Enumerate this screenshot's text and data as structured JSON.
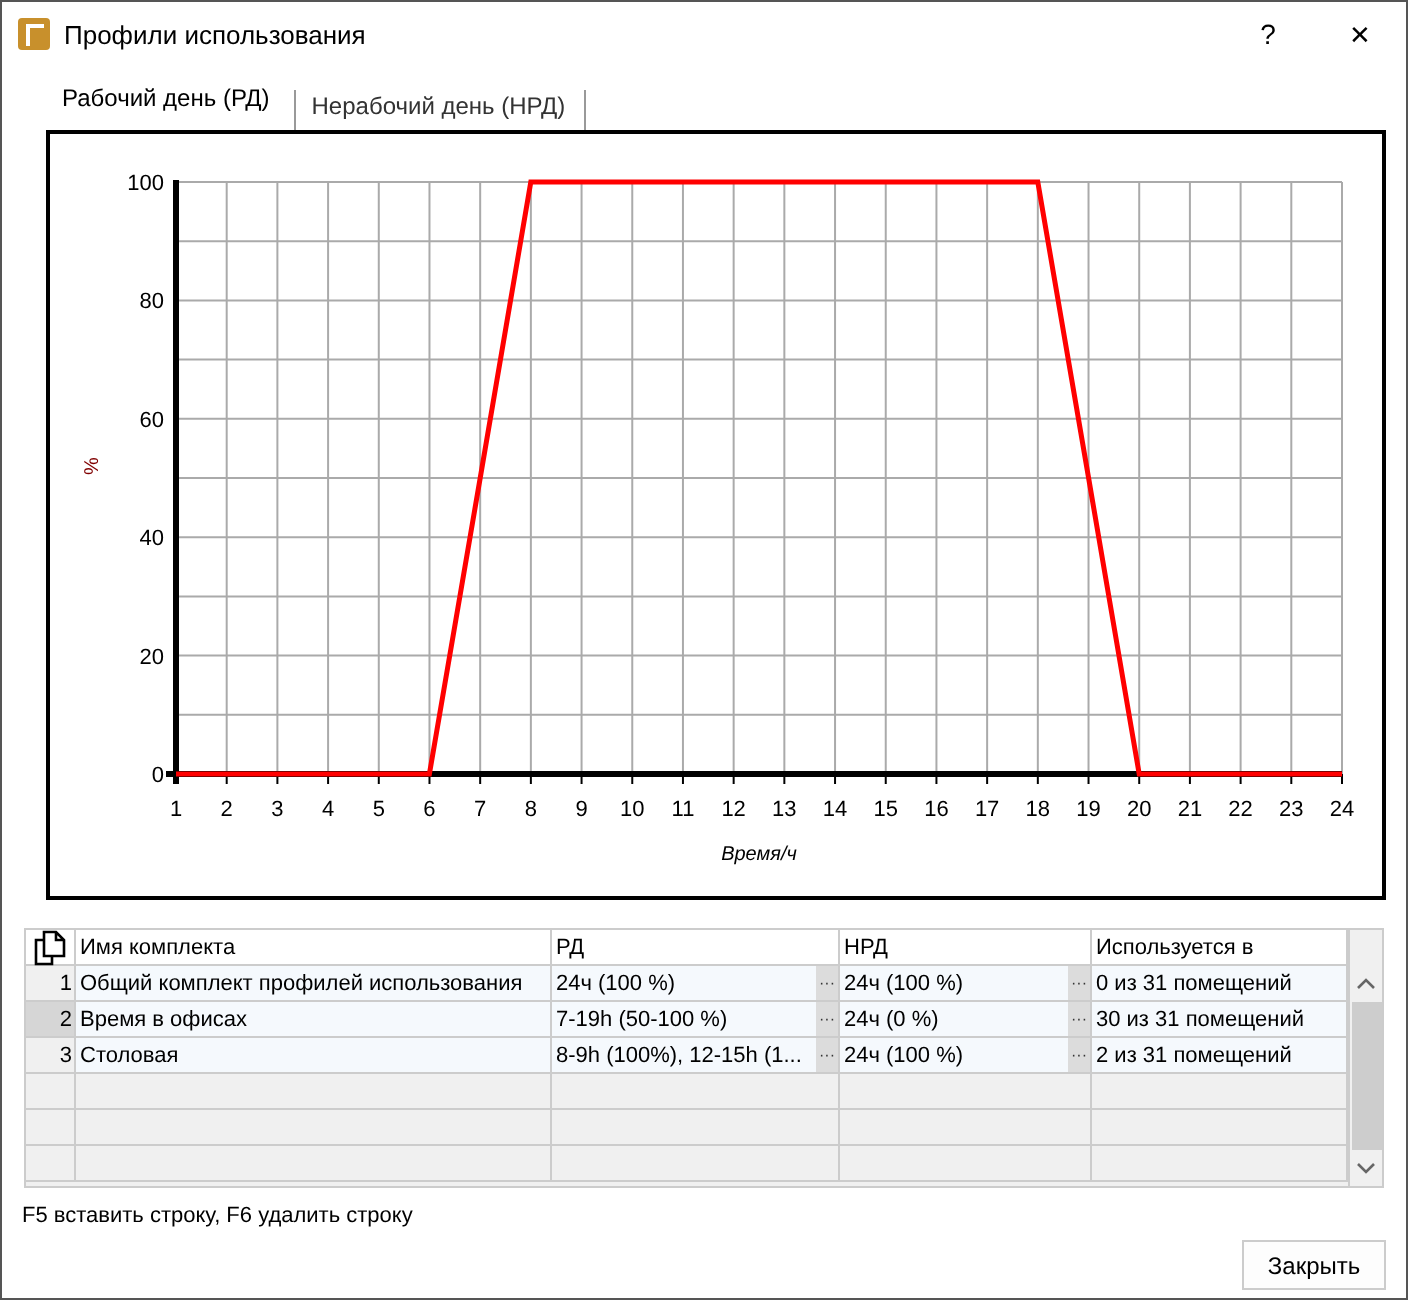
{
  "window": {
    "title": "Профили использования",
    "help": "?",
    "close": "✕"
  },
  "tabs": [
    {
      "label": "Рабочий день (РД)",
      "selected": true
    },
    {
      "label": "Нерабочий день (НРД)",
      "selected": false
    }
  ],
  "chart_data": {
    "type": "line",
    "xlabel": "Время/ч",
    "ylabel": "%",
    "x": [
      1,
      2,
      3,
      4,
      5,
      6,
      7,
      8,
      9,
      10,
      11,
      12,
      13,
      14,
      15,
      16,
      17,
      18,
      19,
      20,
      21,
      22,
      23,
      24
    ],
    "grid": true,
    "series": [
      {
        "color": "#ff0000",
        "values": [
          0,
          0,
          0,
          0,
          0,
          0,
          50,
          100,
          100,
          100,
          100,
          100,
          100,
          100,
          100,
          100,
          100,
          100,
          50,
          0,
          0,
          0,
          0,
          0
        ]
      }
    ],
    "xlim": [
      1,
      24
    ],
    "ylim": [
      0,
      100
    ],
    "xticks": [
      1,
      2,
      3,
      4,
      5,
      6,
      7,
      8,
      9,
      10,
      11,
      12,
      13,
      14,
      15,
      16,
      17,
      18,
      19,
      20,
      21,
      22,
      23,
      24
    ],
    "yticks": [
      0,
      20,
      40,
      60,
      80,
      100
    ]
  },
  "table": {
    "columns": [
      "Имя комплекта",
      "РД",
      "НРД",
      "Используется в"
    ],
    "rows": [
      {
        "number": "1",
        "selected": false,
        "cells": [
          "Общий комплект профилей использования",
          "24ч (100 %)",
          "24ч (100 %)",
          "0 из 31 помещений"
        ]
      },
      {
        "number": "2",
        "selected": true,
        "cells": [
          "Время в офисах",
          "7-19h (50-100 %)",
          "24ч (0 %)",
          "30 из 31 помещений"
        ]
      },
      {
        "number": "3",
        "selected": false,
        "cells": [
          "Столовая",
          "8-9h (100%), 12-15h (1...",
          "24ч (100 %)",
          "2 из 31 помещений"
        ]
      }
    ],
    "ellipsis": "···"
  },
  "hint": "F5 вставить строку, F6 удалить строку",
  "buttons": [
    "Закрыть"
  ]
}
